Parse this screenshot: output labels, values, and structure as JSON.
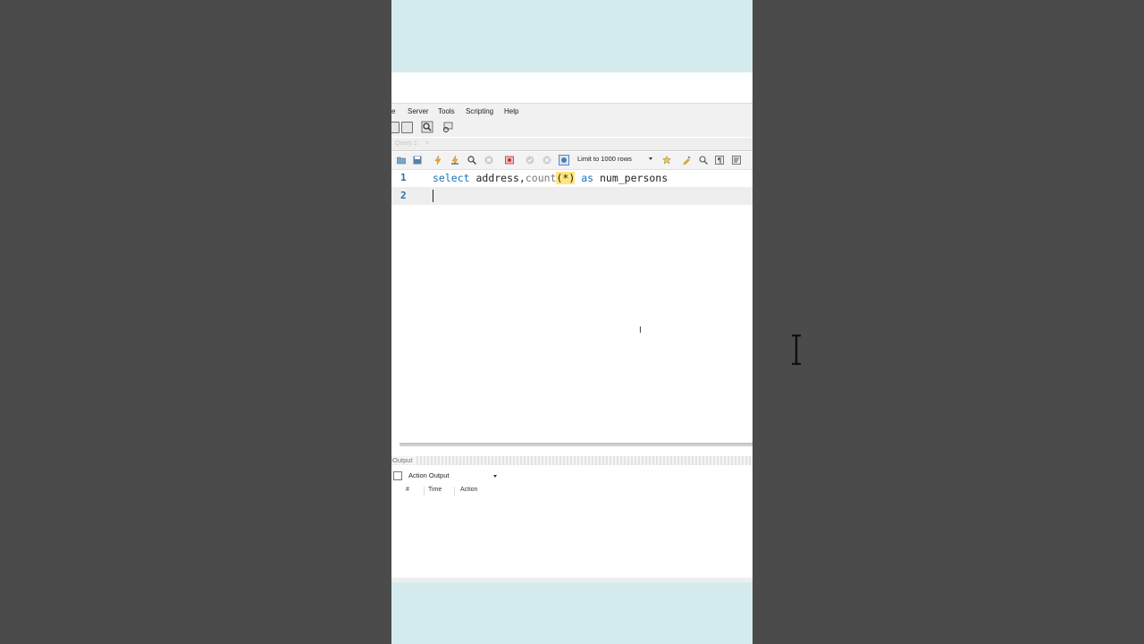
{
  "menu": [
    "e",
    "Server",
    "Tools",
    "Scripting",
    "Help"
  ],
  "tab": {
    "label": "Query 1",
    "close": "×"
  },
  "toolbar": {
    "limit_label": "Limit to 1000 rows",
    "icons": [
      "open-folder-icon",
      "save-icon",
      "execute-icon",
      "execute-current-icon",
      "explain-icon",
      "stop-icon",
      "toggle-error-icon",
      "commit-icon",
      "rollback-icon",
      "autocommit-icon",
      "bookmark-icon",
      "beautify-icon",
      "find-icon",
      "invisible-chars-icon",
      "wrap-icon"
    ]
  },
  "editor": {
    "lines": [
      {
        "number": "1",
        "tokens": [
          {
            "text": "select",
            "kind": "kw"
          },
          {
            "text": " address,",
            "kind": "id"
          },
          {
            "text": "count",
            "kind": "fn"
          },
          {
            "text": "(*)",
            "kind": "hl"
          },
          {
            "text": " ",
            "kind": "id"
          },
          {
            "text": "as",
            "kind": "kw"
          },
          {
            "text": " num_persons",
            "kind": "id"
          }
        ]
      },
      {
        "number": "2",
        "tokens": []
      }
    ],
    "active_line": 2
  },
  "output": {
    "label": "Output",
    "selector": "Action Output",
    "columns": [
      "#",
      "Time",
      "Action"
    ]
  },
  "colors": {
    "page_bg": "#4b4b4b",
    "band": "#d5ecef",
    "keyword": "#1a73b8",
    "highlight": "#ffe680"
  }
}
